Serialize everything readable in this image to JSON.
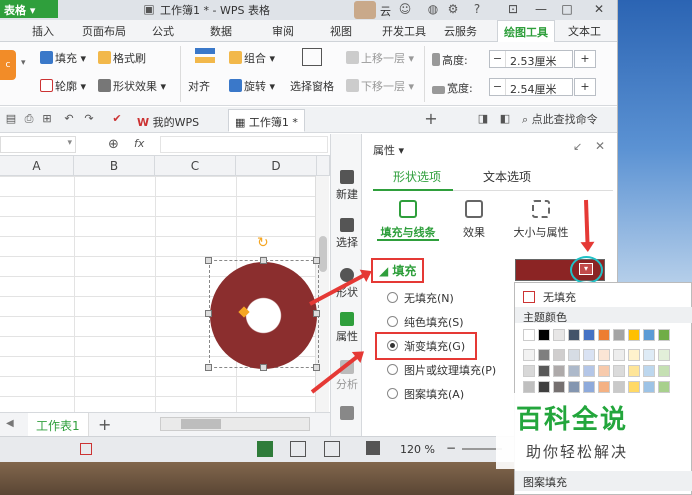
{
  "titlebar": {
    "app_label": "表格",
    "doc_title": "工作簿1 * - WPS 表格",
    "user_label": "云",
    "help_label": "?"
  },
  "tabs": [
    "插入",
    "页面布局",
    "公式",
    "数据",
    "审阅",
    "视图",
    "开发工具",
    "云服务",
    "绘图工具",
    "文本工"
  ],
  "active_tab_index": 8,
  "ribbon": {
    "fill": "填充",
    "format_brush": "格式刷",
    "outline": "轮廓",
    "shape_effect": "形状效果",
    "align": "对齐",
    "group": "组合",
    "rotate": "旋转",
    "select_pane": "选择窗格",
    "move_up": "上移一层",
    "move_down": "下移一层",
    "height_label": "高度:",
    "height_value": "2.53厘米",
    "width_label": "宽度:",
    "width_value": "2.54厘米"
  },
  "quickbar": {
    "tab_mywps": "我的WPS",
    "tab_book": "工作簿1 *",
    "search_cmd": "点此查找命令"
  },
  "formula": {
    "fx": "fx"
  },
  "columns": [
    "A",
    "B",
    "C",
    "D"
  ],
  "sheet": {
    "tab": "工作表1",
    "add": "+"
  },
  "status": {
    "zoom": "120 %"
  },
  "sidebar": [
    "新建",
    "选择",
    "形状",
    "属性",
    "分析"
  ],
  "panel": {
    "title": "属性",
    "tab_shape": "形状选项",
    "tab_text": "文本选项",
    "sub_fill_line": "填充与线条",
    "sub_effect": "效果",
    "sub_size": "大小与属性",
    "section_fill": "填充",
    "options": [
      "无填充(N)",
      "纯色填充(S)",
      "渐变填充(G)",
      "图片或纹理填充(P)",
      "图案填充(A)"
    ],
    "selected_option_index": 2
  },
  "dropdown": {
    "no_fill": "无填充",
    "theme_colors": "主题颜色",
    "pattern_fill": "图案填充"
  },
  "watermark": {
    "big": "百科全说",
    "small": "助你轻松解决"
  },
  "colors": {
    "accent_green": "#2f9f3c",
    "shape_fill": "#8b2e2e",
    "annotation_red": "#e53935",
    "annotation_teal": "#20c1c6"
  }
}
